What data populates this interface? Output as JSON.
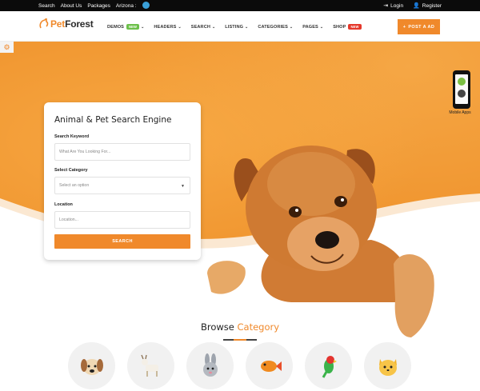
{
  "topbar": {
    "links": [
      "Search",
      "About Us",
      "Packages",
      "Arizona :"
    ],
    "login": "Login",
    "register": "Register"
  },
  "brand": {
    "name_part1": "Pet",
    "name_part2": "Forest",
    "accent": "#f0892b"
  },
  "menu": [
    {
      "label": "DEMOS",
      "badge": "NEW"
    },
    {
      "label": "HEADERS"
    },
    {
      "label": "SEARCH"
    },
    {
      "label": "LISTING"
    },
    {
      "label": "CATEGORIES"
    },
    {
      "label": "PAGES"
    },
    {
      "label": "SHOP",
      "badge": "NEW"
    }
  ],
  "post_ad": "POST A AD",
  "mobile_apps": "Mobile Apps",
  "search_form": {
    "title": "Animal & Pet Search Engine",
    "keyword_label": "Search Keyword",
    "keyword_placeholder": "What Are You Looking For...",
    "category_label": "Select Category",
    "category_value": "Select an option",
    "location_label": "Location",
    "location_placeholder": "Location...",
    "button": "SEARCH"
  },
  "browse": {
    "title_part1": "Browse",
    "title_part2": "Category"
  },
  "categories": [
    "dog-icon",
    "goat-icon",
    "rabbit-icon",
    "fish-icon",
    "parrot-icon",
    "cat-icon"
  ]
}
